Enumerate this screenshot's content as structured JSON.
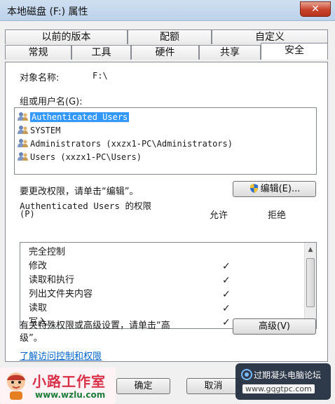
{
  "window": {
    "title": "本地磁盘 (F:) 属性",
    "close_glyph": "✕"
  },
  "tabs_row1": [
    {
      "label": "以前的版本"
    },
    {
      "label": "配额"
    },
    {
      "label": "自定义"
    }
  ],
  "tabs_row2": [
    {
      "label": "常规"
    },
    {
      "label": "工具"
    },
    {
      "label": "硬件"
    },
    {
      "label": "共享"
    },
    {
      "label": "安全",
      "active": true
    }
  ],
  "security": {
    "object_name_label": "对象名称:",
    "object_name_value": "F:\\",
    "groups_label": "组或用户名(G):",
    "users": [
      {
        "name": "Authenticated Users",
        "selected": true
      },
      {
        "name": "SYSTEM"
      },
      {
        "name": "Administrators (xxzx1-PC\\Administrators)"
      },
      {
        "name": "Users (xxzx1-PC\\Users)"
      }
    ],
    "change_hint": "要更改权限，请单击“编辑”。",
    "edit_button": "编辑(E)...",
    "permissions_for_line1": "Authenticated Users 的权限",
    "permissions_for_line2": "(P)",
    "allow_header": "允许",
    "deny_header": "拒绝",
    "permissions": [
      {
        "name": "完全控制",
        "allow": ""
      },
      {
        "name": "修改",
        "allow": "✓"
      },
      {
        "name": "读取和执行",
        "allow": "✓"
      },
      {
        "name": "列出文件夹内容",
        "allow": "✓"
      },
      {
        "name": "读取",
        "allow": "✓"
      },
      {
        "name": "写入",
        "allow": "✓"
      }
    ],
    "advanced_hint_line1": "有关特殊权限或高级设置，请单击“高",
    "advanced_hint_line2": "级”。",
    "advanced_button": "高级(V)",
    "learn_link": "了解访问控制和权限"
  },
  "footer": {
    "ok_button": "确定",
    "cancel_button": "取消"
  },
  "watermarks": {
    "left_brand": "小路工作室",
    "left_url": "www.wzlu.com",
    "right_brand": "过期凝头电脑论坛",
    "right_url": "www.gqgtpc.com"
  },
  "colors": {
    "selection": "#3399ff",
    "link": "#0066cc",
    "title_bar": "#c4d6ec"
  }
}
